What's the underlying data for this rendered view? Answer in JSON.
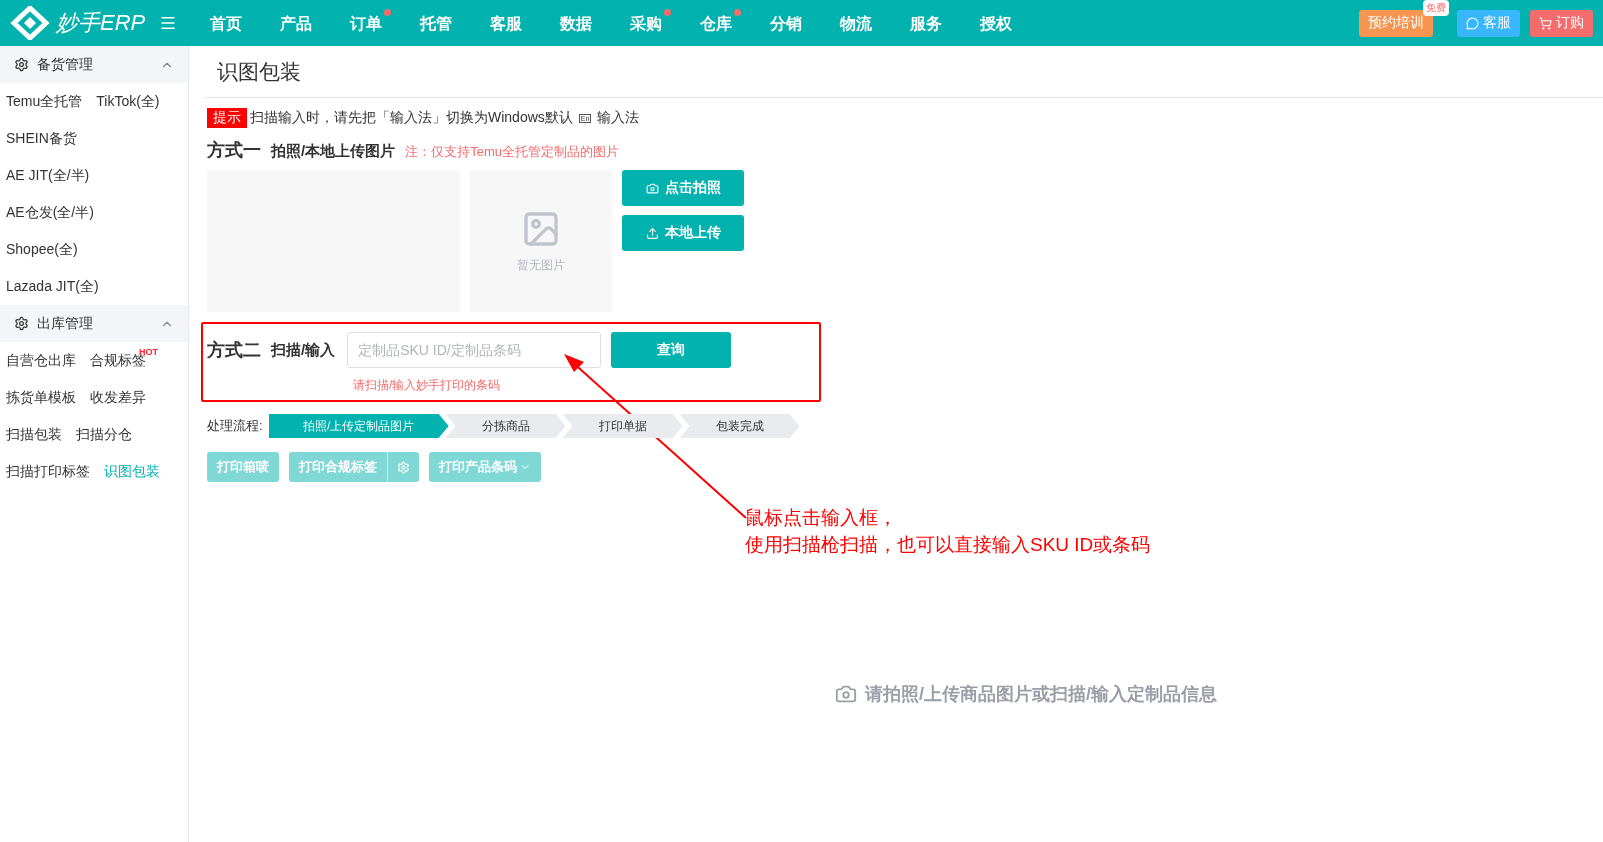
{
  "topbar": {
    "logo": "妙手ERP",
    "nav": [
      {
        "label": "首页",
        "dot": false
      },
      {
        "label": "产品",
        "dot": false
      },
      {
        "label": "订单",
        "dot": true
      },
      {
        "label": "托管",
        "dot": false
      },
      {
        "label": "客服",
        "dot": false
      },
      {
        "label": "数据",
        "dot": false
      },
      {
        "label": "采购",
        "dot": true
      },
      {
        "label": "仓库",
        "dot": true
      },
      {
        "label": "分销",
        "dot": false
      },
      {
        "label": "物流",
        "dot": false
      },
      {
        "label": "服务",
        "dot": false
      },
      {
        "label": "授权",
        "dot": false
      }
    ],
    "training": {
      "label": "预约培训",
      "badge": "免费"
    },
    "service": "客服",
    "order": "订购"
  },
  "sidebar": [
    {
      "title": "备货管理",
      "expanded": true,
      "items": [
        {
          "label": "Temu全托管",
          "selected": false
        },
        {
          "label": "TikTok(全)",
          "selected": false
        },
        {
          "label": "SHEIN备货",
          "selected": false
        },
        {
          "label": "AE JIT(全/半)",
          "selected": false
        },
        {
          "label": "AE仓发(全/半)",
          "selected": false
        },
        {
          "label": "Shopee(全)",
          "selected": false
        },
        {
          "label": "Lazada JIT(全)",
          "selected": false
        }
      ]
    },
    {
      "title": "出库管理",
      "expanded": true,
      "items": [
        {
          "label": "自营仓出库",
          "selected": false
        },
        {
          "label": "合规标签",
          "selected": false,
          "badge": "HOT"
        },
        {
          "label": "拣货单模板",
          "selected": false
        },
        {
          "label": "收发差异",
          "selected": false
        },
        {
          "label": "扫描包装",
          "selected": false
        },
        {
          "label": "扫描分仓",
          "selected": false
        },
        {
          "label": "扫描打印标签",
          "selected": false
        },
        {
          "label": "识图包装",
          "selected": true
        }
      ]
    }
  ],
  "page_title": "识图包装",
  "tip": {
    "label": "提示",
    "text": "扫描输入时，请先把「输入法」切换为Windows默认",
    "ime_icon": "En",
    "text_after": "输入法"
  },
  "method_one": {
    "title": "方式一",
    "subtitle": "拍照/本地上传图片",
    "note": "注：仅支持Temu全托管定制品的图片",
    "empty_image": "暂无图片",
    "buttons": [
      "点击拍照",
      "本地上传"
    ]
  },
  "method_two": {
    "title": "方式二",
    "subtitle": "扫描/输入",
    "placeholder": "定制品SKU ID/定制品条码",
    "button": "查询",
    "hint": "请扫描/输入妙手打印的条码"
  },
  "process": {
    "label": "处理流程:",
    "steps": [
      {
        "label": "拍照/上传定制品图片",
        "selected": true
      },
      {
        "label": "分拣商品",
        "selected": false
      },
      {
        "label": "打印单据",
        "selected": false
      },
      {
        "label": "包装完成",
        "selected": false
      }
    ]
  },
  "actions": [
    {
      "label": "打印箱唛",
      "kind": "plain",
      "disabled": true
    },
    {
      "label": "打印合规标签",
      "kind": "settings",
      "disabled": true
    },
    {
      "label": "打印产品条码",
      "kind": "dropdown",
      "disabled": true
    }
  ],
  "empty_state": "请拍照/上传商品图片或扫描/输入定制品信息",
  "annotation": [
    "鼠标点击输入框，",
    "使用扫描枪扫描，也可以直接输入SKU ID或条码"
  ]
}
